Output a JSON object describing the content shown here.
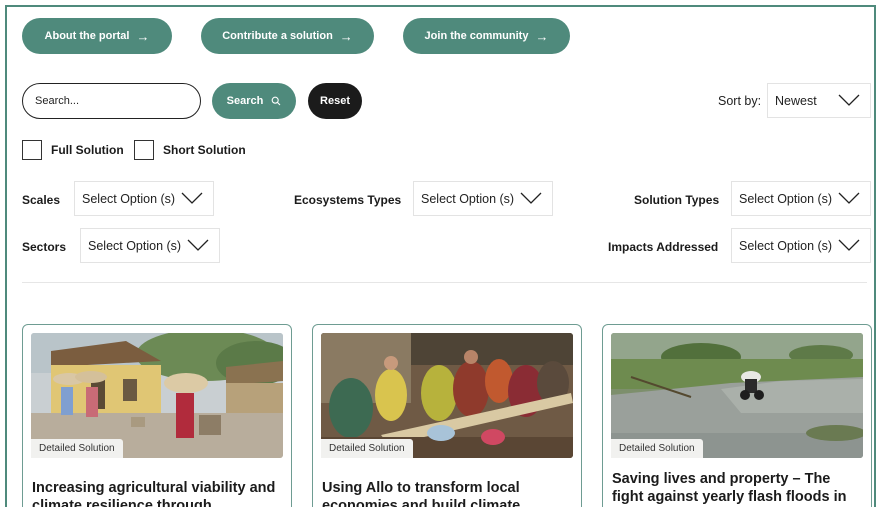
{
  "top_links": [
    {
      "label": "About the portal",
      "icon": "arrow-right-icon"
    },
    {
      "label": "Contribute a solution",
      "icon": "arrow-right-icon"
    },
    {
      "label": "Join the community",
      "icon": "arrow-right-icon"
    }
  ],
  "search": {
    "placeholder": "Search...",
    "button_label": "Search",
    "button_icon": "magnifier-icon",
    "reset_label": "Reset"
  },
  "sort": {
    "label": "Sort by:",
    "value": "Newest"
  },
  "checkboxes": [
    {
      "label": "Full Solution",
      "checked": false
    },
    {
      "label": "Short Solution",
      "checked": false
    }
  ],
  "filters": {
    "scales": {
      "label": "Scales",
      "value": "Select Option (s)"
    },
    "ecosystems": {
      "label": "Ecosystems Types",
      "value": "Select Option (s)"
    },
    "solution_types": {
      "label": "Solution Types",
      "value": "Select Option (s)"
    },
    "sectors": {
      "label": "Sectors",
      "value": "Select Option (s)"
    },
    "impacts": {
      "label": "Impacts Addressed",
      "value": "Select Option (s)"
    }
  },
  "cards": [
    {
      "badge": "Detailed Solution",
      "title": "Increasing agricultural viability and climate resilience through"
    },
    {
      "badge": "Detailed Solution",
      "title": "Using Allo to transform local economies and build climate"
    },
    {
      "badge": "Detailed Solution",
      "title": "Saving lives and property – The fight against yearly flash floods in"
    }
  ],
  "colors": {
    "accent": "#4f8a7c",
    "dark": "#1b1b1b",
    "card_border": "#6e9c92"
  }
}
